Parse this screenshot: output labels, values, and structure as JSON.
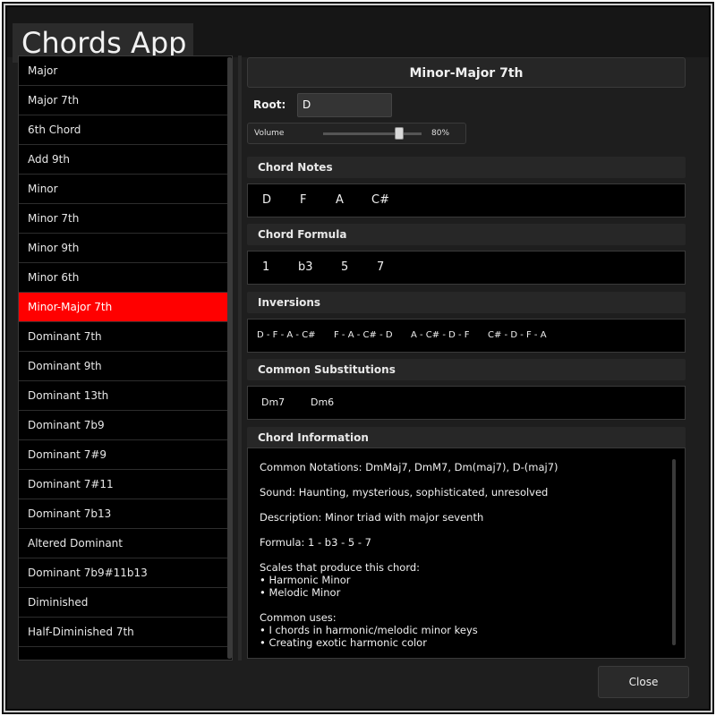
{
  "app": {
    "title": "Chords App"
  },
  "chord_list": [
    "Major",
    "Major 7th",
    "6th Chord",
    "Add 9th",
    "Minor",
    "Minor 7th",
    "Minor 9th",
    "Minor 6th",
    "Minor-Major 7th",
    "Dominant 7th",
    "Dominant 9th",
    "Dominant 13th",
    "Dominant 7b9",
    "Dominant 7#9",
    "Dominant 7#11",
    "Dominant 7b13",
    "Altered Dominant",
    "Dominant 7b9#11b13",
    "Diminished",
    "Half-Diminished 7th"
  ],
  "selected_index": 8,
  "detail": {
    "title": "Minor-Major 7th",
    "root_label": "Root:",
    "root_value": "D",
    "volume_label": "Volume",
    "volume_value": "80%",
    "volume_level": 0.8
  },
  "sections": {
    "notes": {
      "header": "Chord Notes",
      "items": [
        "D",
        "F",
        "A",
        "C#"
      ]
    },
    "formula": {
      "header": "Chord Formula",
      "items": [
        "1",
        "b3",
        "5",
        "7"
      ]
    },
    "inversions": {
      "header": "Inversions",
      "items": [
        "D - F - A - C#",
        "F - A - C# - D",
        "A - C# - D - F",
        "C# - D - F - A"
      ]
    },
    "substitutions": {
      "header": "Common Substitutions",
      "items": [
        "Dm7",
        "Dm6"
      ]
    },
    "info": {
      "header": "Chord Information",
      "notations": "Common Notations: DmMaj7, DmM7, Dm(maj7), D-(maj7)",
      "sound": "Sound: Haunting, mysterious, sophisticated, unresolved",
      "description": "Description: Minor triad with major seventh",
      "formula": "Formula: 1 - b3 - 5 - 7",
      "scales_title": "Scales that produce this chord:",
      "scales": [
        "• Harmonic Minor",
        "• Melodic Minor"
      ],
      "uses_title": "Common uses:",
      "uses": [
        "• I chords in harmonic/melodic minor keys",
        "• Creating exotic harmonic color"
      ]
    }
  },
  "buttons": {
    "close": "Close"
  }
}
